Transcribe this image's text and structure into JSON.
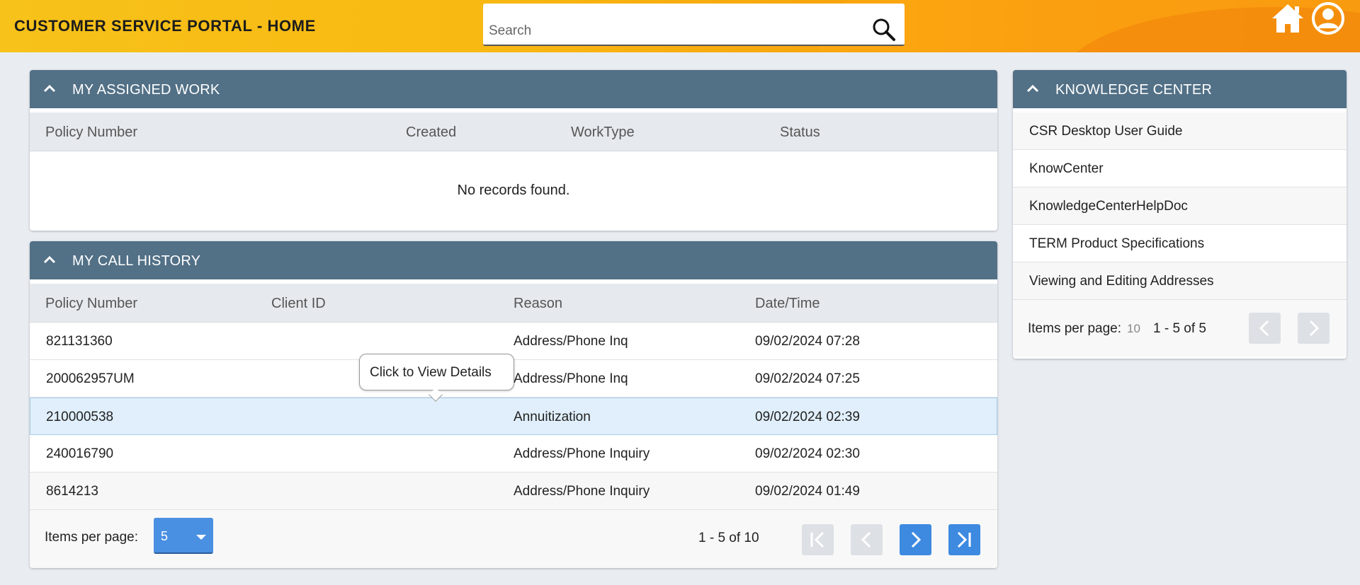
{
  "header": {
    "title": "CUSTOMER SERVICE PORTAL - HOME",
    "search_placeholder": "Search",
    "colors": {
      "gradient_start": "#f7c21a",
      "gradient_end": "#f28a0b"
    }
  },
  "assigned_work": {
    "title": "MY ASSIGNED WORK",
    "columns": [
      "Policy Number",
      "Created",
      "WorkType",
      "Status"
    ],
    "empty_message": "No records found."
  },
  "call_history": {
    "title": "MY CALL HISTORY",
    "columns": [
      "Policy Number",
      "Client ID",
      "Reason",
      "Date/Time"
    ],
    "rows": [
      {
        "policy": "821131360",
        "client_id": "",
        "reason": "Address/Phone Inq",
        "datetime": "09/02/2024 07:28"
      },
      {
        "policy": "200062957UM",
        "client_id": "",
        "reason": "Address/Phone Inq",
        "datetime": "09/02/2024 07:25"
      },
      {
        "policy": "210000538",
        "client_id": "",
        "reason": "Annuitization",
        "datetime": "09/02/2024 02:39"
      },
      {
        "policy": "240016790",
        "client_id": "",
        "reason": "Address/Phone Inquiry",
        "datetime": "09/02/2024 02:30"
      },
      {
        "policy": "8614213",
        "client_id": "",
        "reason": "Address/Phone Inquiry",
        "datetime": "09/02/2024 01:49"
      }
    ],
    "tooltip": "Click to View Details",
    "pager": {
      "items_per_page_label": "Items per page:",
      "items_per_page": "5",
      "range": "1 - 5 of 10"
    }
  },
  "knowledge_center": {
    "title": "KNOWLEDGE CENTER",
    "items": [
      "CSR Desktop User Guide",
      "KnowCenter",
      "KnowledgeCenterHelpDoc",
      "TERM Product Specifications",
      "Viewing and Editing Addresses"
    ],
    "pager": {
      "items_per_page_label": "Items per page:",
      "items_per_page": "10",
      "range": "1 - 5 of 5"
    }
  },
  "colors": {
    "panel_header": "#527086",
    "page_bg": "#e9edf2",
    "accent_blue": "#3d8ae0",
    "highlight_row": "#e0effb"
  },
  "icons": [
    "search-icon",
    "home-icon",
    "user-icon",
    "chevron-up-icon",
    "first-page-icon",
    "prev-page-icon",
    "next-page-icon",
    "last-page-icon"
  ]
}
